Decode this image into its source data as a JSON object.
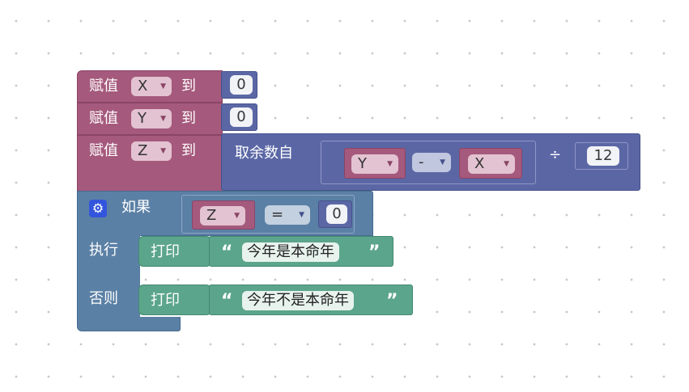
{
  "blocks": {
    "set1": {
      "keyword": "赋值",
      "var": "X",
      "to": "到",
      "value": "0"
    },
    "set2": {
      "keyword": "赋值",
      "var": "Y",
      "to": "到",
      "value": "0"
    },
    "set3": {
      "keyword": "赋值",
      "var": "Z",
      "to": "到",
      "func": "取余数自",
      "left_var": "Y",
      "op": "-",
      "right_var": "X",
      "div": "÷",
      "divisor": "12"
    },
    "if_block": {
      "if_label": "如果",
      "cond_var": "Z",
      "cond_op": "=",
      "cond_value": "0",
      "do_label": "执行",
      "else_label": "否则"
    },
    "print1": {
      "label": "打印",
      "open_quote": "“",
      "text": "今年是本命年",
      "close_quote": "”"
    },
    "print2": {
      "label": "打印",
      "open_quote": "“",
      "text": "今年不是本命年",
      "close_quote": "”"
    }
  },
  "colors": {
    "variables": "#a5597c",
    "math": "#5b67a5",
    "logic": "#5b80a5",
    "text": "#5ba58c"
  }
}
